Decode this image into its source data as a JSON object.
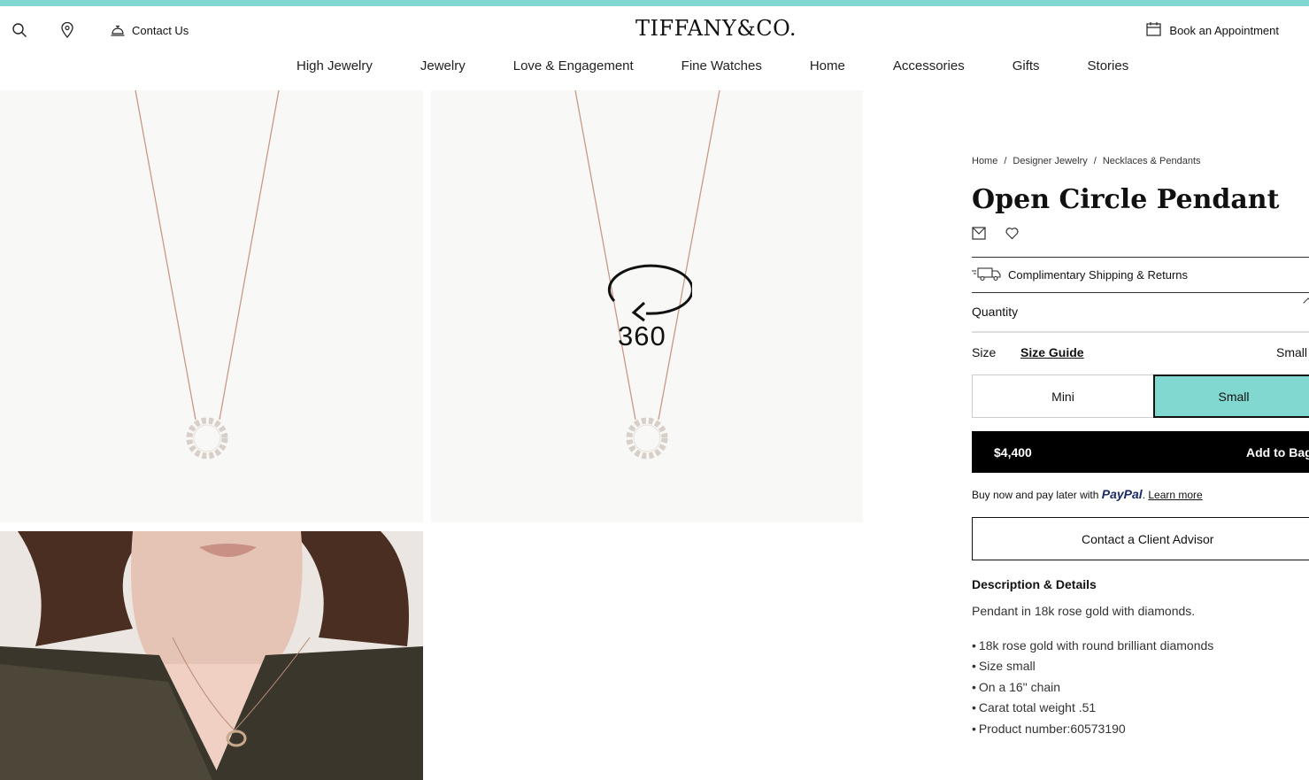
{
  "header": {
    "contact_label": "Contact Us",
    "logo_text": "TIFFANY&CO.",
    "appointment_label": "Book an Appointment",
    "icons": [
      "search-icon",
      "location-pin-icon",
      "service-bell-icon",
      "calendar-icon"
    ]
  },
  "nav": {
    "items": [
      "High Jewelry",
      "Jewelry",
      "Love & Engagement",
      "Fine Watches",
      "Home",
      "Accessories",
      "Gifts",
      "Stories"
    ]
  },
  "gallery": {
    "rotate_label": "360"
  },
  "product": {
    "breadcrumbs": [
      "Home",
      "Designer Jewelry",
      "Necklaces & Pendants"
    ],
    "breadcrumb_separator": "/",
    "title": "Open Circle Pendant",
    "shipping_label": "Complimentary Shipping & Returns",
    "quantity_label": "Quantity",
    "size_label": "Size",
    "size_guide_label": "Size Guide",
    "size_selected": "Small",
    "size_options": [
      "Mini",
      "Small"
    ],
    "price": "$4,400",
    "add_to_bag_label": "Add to Bag",
    "paypal": {
      "prefix": "Buy now and pay later with ",
      "brand": "PayPal",
      "suffix": ". ",
      "learn_more": "Learn more"
    },
    "advisor_label": "Contact a Client Advisor",
    "description_heading": "Description & Details",
    "description_text": "Pendant in 18k rose gold with diamonds.",
    "details": [
      "18k rose gold with round brilliant diamonds",
      "Size small",
      "On a 16\" chain",
      "Carat total weight .51",
      "Product number:60573190"
    ]
  },
  "colors": {
    "accent": "#81d8d0",
    "button_dark": "#000000",
    "tile_background": "#f8f8f7"
  }
}
